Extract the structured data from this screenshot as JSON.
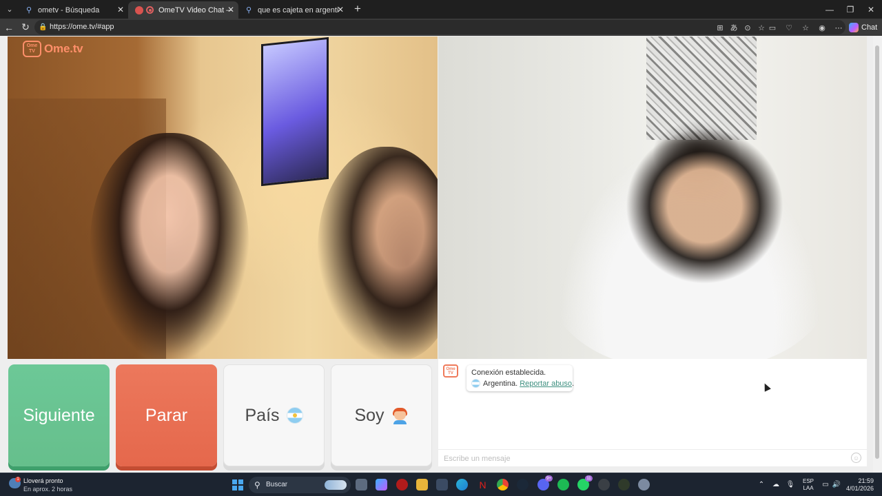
{
  "browser": {
    "tabs": [
      {
        "title": "ometv - Búsqueda",
        "active": false
      },
      {
        "title": "OmeTV Video Chat — Omegle Alternative",
        "active": true
      },
      {
        "title": "que es cajeta en argentina - Búsqueda",
        "active": false
      }
    ],
    "url": "https://ome.tv/#app",
    "chat_label": "Chat"
  },
  "app": {
    "brand_badge": "Ome\nTV",
    "brand_name": "Ome.tv",
    "buttons": {
      "next": "Siguiente",
      "stop": "Parar",
      "country": "País",
      "gender": "Soy"
    },
    "chat": {
      "system_badge": "Ome\nTV",
      "status": "Conexión establecida.",
      "country": "Argentina.",
      "report_link": "Reportar abuso",
      "report_suffix": ".",
      "input_placeholder": "Escribe un mensaje"
    }
  },
  "taskbar": {
    "weather_title": "Lloverá pronto",
    "weather_sub": "En aprox. 2 horas",
    "weather_badge": "1",
    "search_label": "Buscar",
    "lang_1": "ESP",
    "lang_2": "LAA",
    "time": "21:59",
    "date": "4/01/2026",
    "badges": {
      "discord": "9+",
      "whatsapp": "11"
    }
  },
  "colors": {
    "next_button": "#66bf8c",
    "stop_button": "#e5684c",
    "brand": "#ff8f6a",
    "link": "#3d8f7f"
  }
}
